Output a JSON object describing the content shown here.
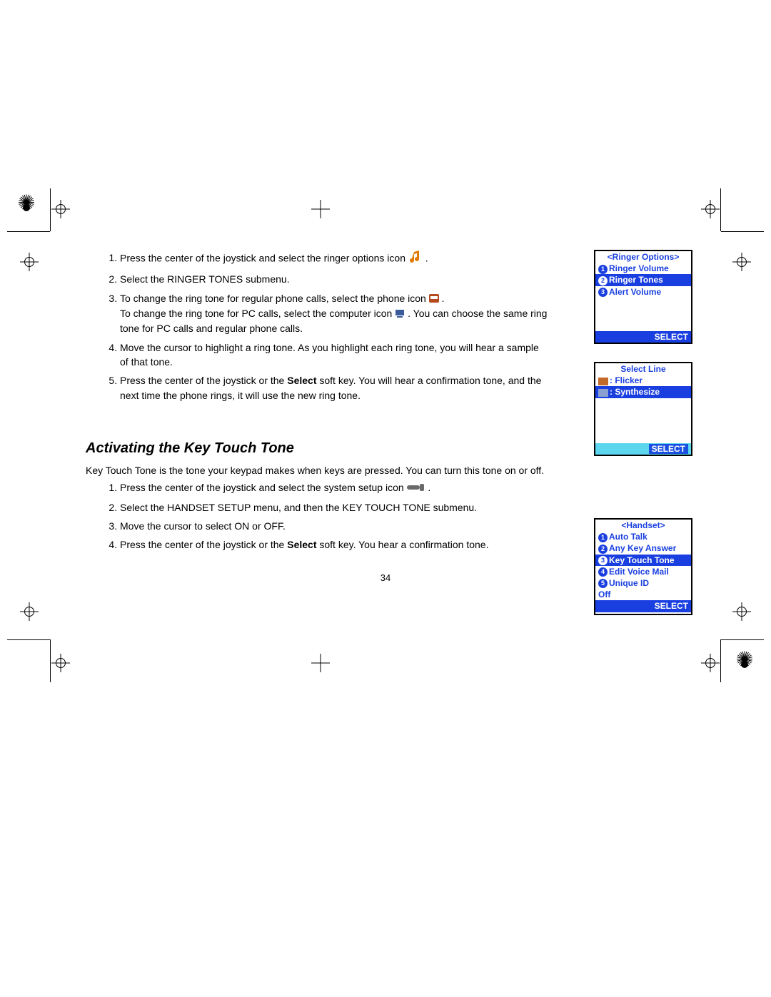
{
  "page_number": "34",
  "section1": {
    "steps": [
      {
        "pre": "Press the center of the joystick and select the ringer options icon ",
        "post": "."
      },
      {
        "text": "Select the RINGER TONES submenu."
      },
      {
        "line1_pre": "To change the ring tone for regular phone calls, select the phone icon ",
        "line1_post": ".",
        "line2_pre": "To change the ring tone for PC calls, select the computer icon ",
        "line2_post": ". You can choose the same ring tone for PC calls and regular phone calls."
      },
      {
        "text": "Move the cursor to highlight a ring tone. As you highlight each ring tone, you will hear a sample of that tone."
      },
      {
        "pre": "Press the center of the joystick or the ",
        "bold": "Select",
        "post": " soft key. You will hear a confirmation tone, and the next time the phone rings, it will use the new ring tone."
      }
    ]
  },
  "section2": {
    "heading": "Activating the Key Touch Tone",
    "intro": "Key Touch Tone is the tone your keypad makes when keys are pressed. You can turn this tone on or off.",
    "steps": [
      {
        "pre": "Press the center of the joystick and select the system setup icon ",
        "post": "."
      },
      {
        "text": "Select the HANDSET SETUP menu, and then the KEY TOUCH TONE submenu."
      },
      {
        "text": "Move the cursor to select ON or OFF."
      },
      {
        "pre": "Press the center of the joystick or the ",
        "bold": "Select",
        "post": " soft key. You hear a confirmation tone."
      }
    ]
  },
  "screen1": {
    "title": "<Ringer Options>",
    "items": [
      {
        "n": "1",
        "label": "Ringer Volume",
        "hl": false
      },
      {
        "n": "2",
        "label": "Ringer Tones",
        "hl": true
      },
      {
        "n": "3",
        "label": "Alert Volume",
        "hl": false
      }
    ],
    "select": "SELECT"
  },
  "screen2": {
    "title": "Select Line",
    "items": [
      {
        "label": ": Flicker",
        "hl": false
      },
      {
        "label": ": Synthesize",
        "hl": true
      }
    ],
    "select": "SELECT"
  },
  "screen3": {
    "title": "<Handset>",
    "items": [
      {
        "n": "1",
        "label": "Auto Talk",
        "hl": false
      },
      {
        "n": "2",
        "label": "Any Key Answer",
        "hl": false
      },
      {
        "n": "3",
        "label": "Key Touch Tone",
        "hl": true
      },
      {
        "n": "4",
        "label": "Edit Voice Mail",
        "hl": false
      },
      {
        "n": "5",
        "label": "Unique ID",
        "hl": false
      }
    ],
    "status": "Off",
    "select": "SELECT"
  }
}
